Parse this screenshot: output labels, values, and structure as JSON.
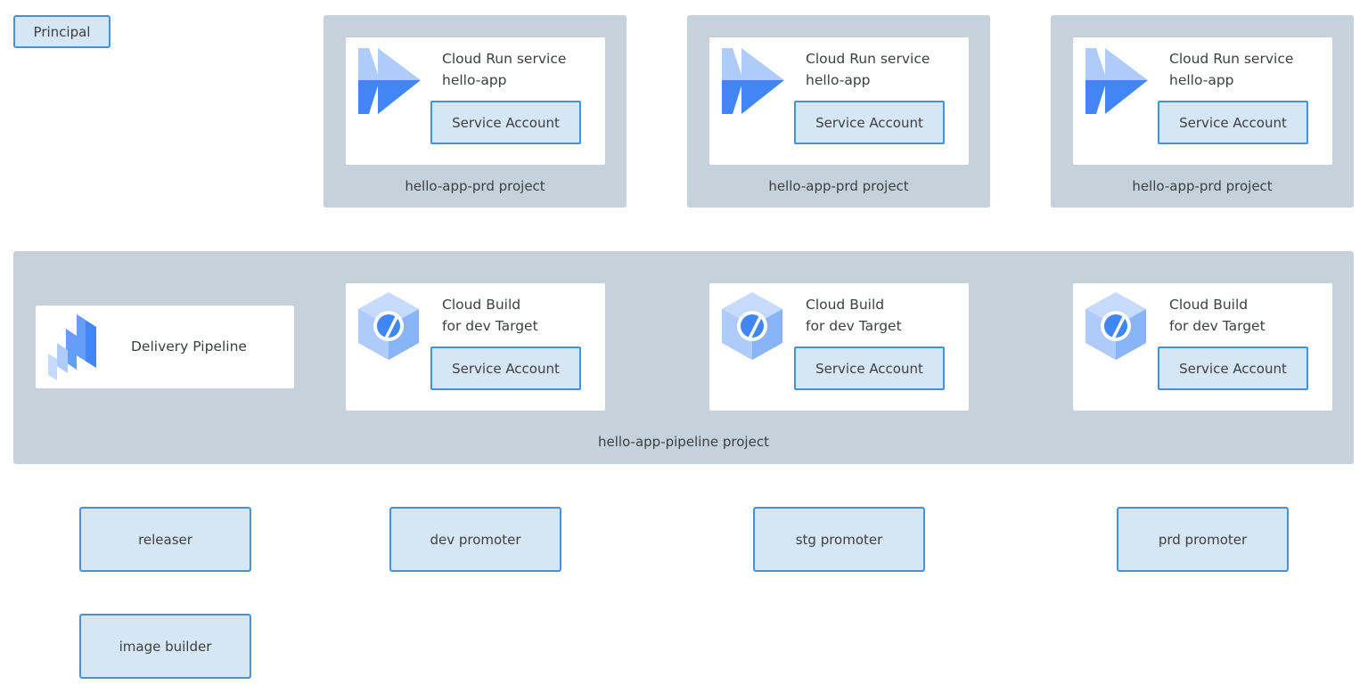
{
  "principal": {
    "label": "Principal"
  },
  "run_projects": [
    {
      "project_label": "hello-app-prd project",
      "service_type": "Cloud Run service",
      "service_name": "hello-app",
      "sa_label": "Service Account"
    },
    {
      "project_label": "hello-app-prd project",
      "service_type": "Cloud Run service",
      "service_name": "hello-app",
      "sa_label": "Service Account"
    },
    {
      "project_label": "hello-app-prd project",
      "service_type": "Cloud Run service",
      "service_name": "hello-app",
      "sa_label": "Service Account"
    }
  ],
  "pipeline_project": {
    "label": "hello-app-pipeline project",
    "delivery_pipeline": {
      "label": "Delivery Pipeline"
    },
    "builds": [
      {
        "title": "Cloud Build",
        "subtitle": "for dev Target",
        "sa_label": "Service Account"
      },
      {
        "title": "Cloud Build",
        "subtitle": "for dev Target",
        "sa_label": "Service Account"
      },
      {
        "title": "Cloud Build",
        "subtitle": "for dev Target",
        "sa_label": "Service Account"
      }
    ]
  },
  "roles": {
    "releaser": "releaser",
    "dev_promoter": "dev promoter",
    "stg_promoter": "stg promoter",
    "prd_promoter": "prd promoter",
    "image_builder": "image builder"
  },
  "icons": {
    "cloud_run": "cloud-run-icon",
    "cloud_build": "cloud-build-icon",
    "delivery_pipeline": "cloud-deploy-icon"
  },
  "colors": {
    "project_bg": "#c5d2db",
    "box_fill": "#d6e6f5",
    "box_border": "#4a90d9",
    "icon_dark": "#4285f4",
    "icon_light": "#aecbfa"
  }
}
